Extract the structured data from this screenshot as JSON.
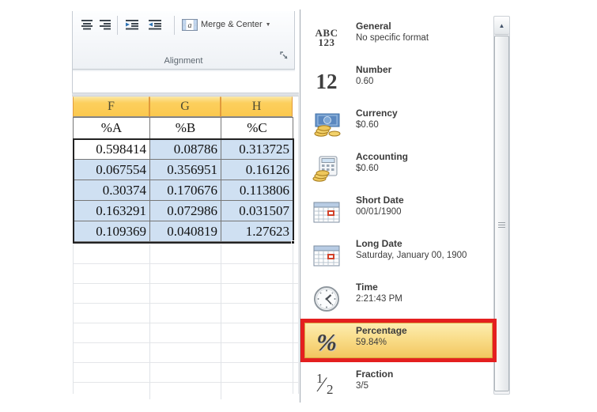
{
  "ribbon": {
    "group_label": "Alignment",
    "merge_center_label": "Merge & Center",
    "merge_dropdown_arrow": "▼",
    "merge_icon_letter": "a"
  },
  "sheet": {
    "column_letters": [
      "F",
      "G",
      "H"
    ],
    "header_row": [
      "%A",
      "%B",
      "%C"
    ],
    "data_rows": [
      [
        "0.598414",
        "0.08786",
        "0.313725"
      ],
      [
        "0.067554",
        "0.356951",
        "0.16126"
      ],
      [
        "0.30374",
        "0.170676",
        "0.113806"
      ],
      [
        "0.163291",
        "0.072986",
        "0.031507"
      ],
      [
        "0.109369",
        "0.040819",
        "1.27623"
      ]
    ]
  },
  "format_menu": {
    "items": [
      {
        "label": "General",
        "example": "No specific format"
      },
      {
        "label": "Number",
        "example": "0.60"
      },
      {
        "label": "Currency",
        "example": "$0.60"
      },
      {
        "label": "Accounting",
        "example": "$0.60"
      },
      {
        "label": "Short Date",
        "example": "00/01/1900"
      },
      {
        "label": "Long Date",
        "example": "Saturday, January 00, 1900"
      },
      {
        "label": "Time",
        "example": "2:21:43 PM"
      },
      {
        "label": "Percentage",
        "example": "59.84%",
        "highlighted": "true"
      },
      {
        "label": "Fraction",
        "example": "3/5"
      }
    ],
    "glyphs": {
      "general_top": "ABC",
      "general_bottom": "123",
      "number": "12",
      "percent": "%",
      "fraction_num": "1",
      "fraction_slash": "⁄",
      "fraction_den": "2"
    },
    "scroll_up_arrow": "▲"
  },
  "colors": {
    "annotation_red": "#E41F1F",
    "highlight_yellow_top": "#FDEEB2",
    "highlight_yellow_bottom": "#F2C55E",
    "selected_header_orange": "#FBC84E",
    "selection_blue": "#CFE0F2"
  }
}
